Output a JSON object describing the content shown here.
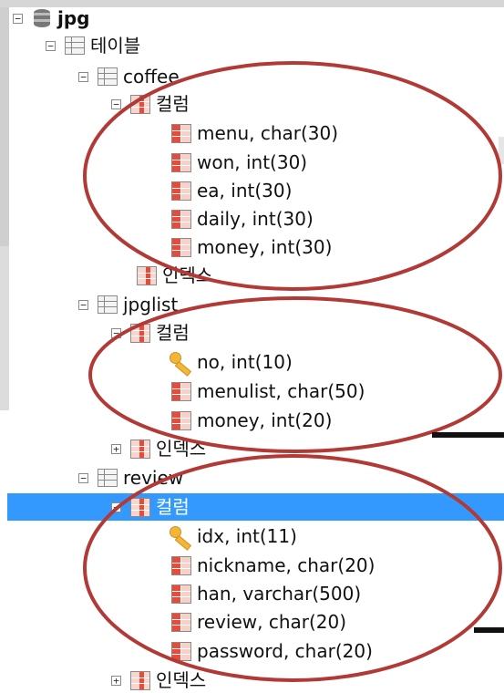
{
  "colors": {
    "selection": "#3399ff",
    "annotation": "#b23a36"
  },
  "tree": {
    "db": {
      "label": "jpg",
      "icon": "database-icon"
    },
    "tables_folder": {
      "label": "테이블"
    },
    "coffee": {
      "label": "coffee",
      "columns_label": "컬럼",
      "columns": [
        "menu, char(30)",
        "won, int(30)",
        "ea, int(30)",
        "daily, int(30)",
        "money, int(30)"
      ],
      "index_label": "인덱스"
    },
    "jpglist": {
      "label": "jpglist",
      "columns_label": "컬럼",
      "columns": [
        "no, int(10)",
        "menulist, char(50)",
        "money, int(20)"
      ],
      "index_label": "인덱스"
    },
    "review": {
      "label": "review",
      "columns_label": "컬럼",
      "columns": [
        "idx, int(11)",
        "nickname, char(20)",
        "han, varchar(500)",
        "review, char(20)",
        "password, char(20)"
      ],
      "index_label": "인덱스"
    }
  },
  "toggles": {
    "expanded": "−",
    "collapsed": "+"
  }
}
